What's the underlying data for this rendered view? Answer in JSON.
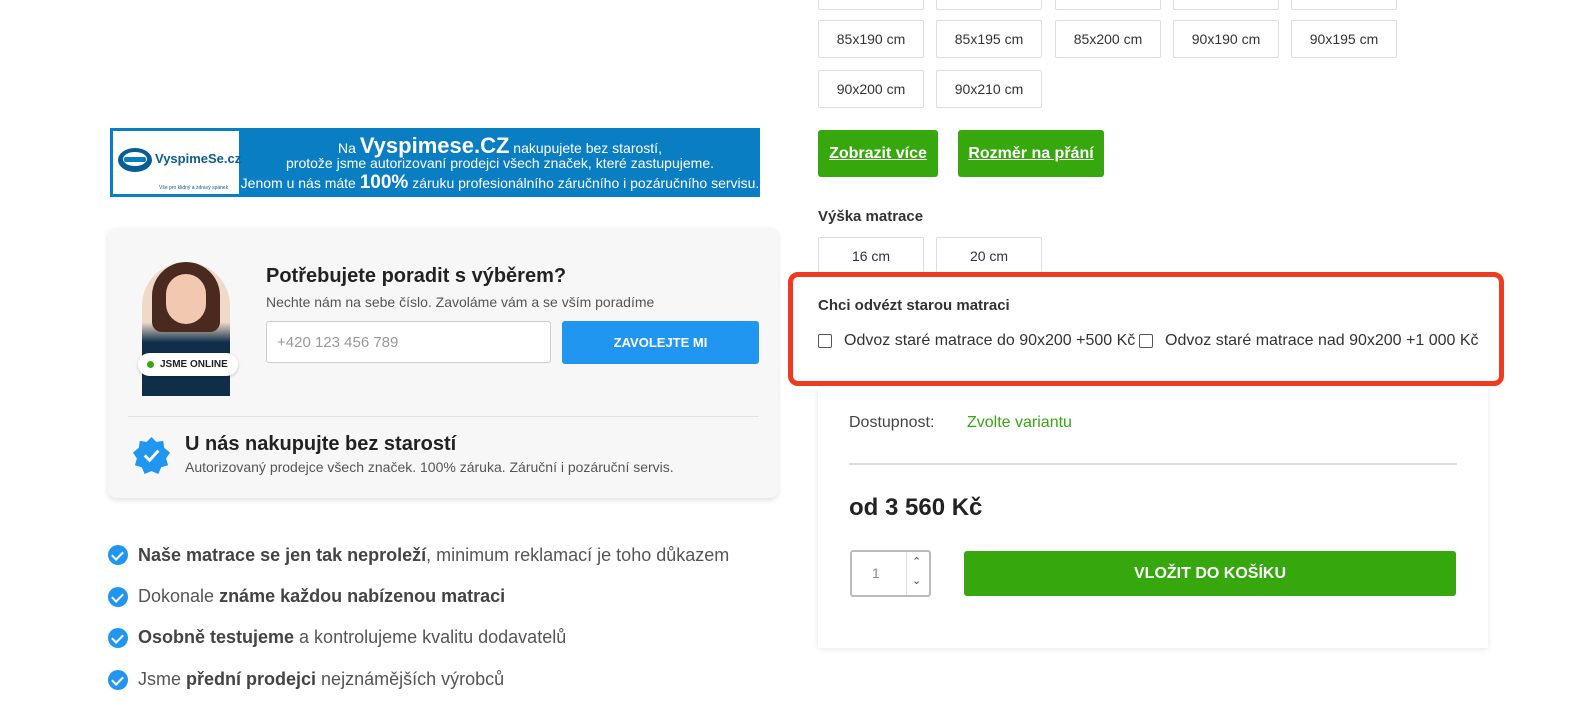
{
  "sizes": {
    "top_row": [
      "",
      "",
      "",
      "",
      ""
    ],
    "row1": [
      "85x190 cm",
      "85x195 cm",
      "85x200 cm",
      "90x190 cm",
      "90x195 cm"
    ],
    "row2": [
      "90x200 cm",
      "90x210 cm"
    ],
    "show_more": "Zobrazit více",
    "custom_size": "Rozměr na přání"
  },
  "height": {
    "label": "Výška matrace",
    "options": [
      "16 cm",
      "20 cm"
    ]
  },
  "disposal": {
    "label": "Chci odvézt starou matraci",
    "option1": "Odvoz staré matrace do 90x200 +500 Kč",
    "option2": "Odvoz staré matrace nad 90x200 +1 000 Kč",
    "highlight_color": "#ee3a1f"
  },
  "purchase": {
    "availability_label": "Dostupnost:",
    "availability_value": "Zvolte variantu",
    "price": "od 3 560 Kč",
    "quantity": "1",
    "add_to_cart": "VLOŽIT DO KOŠÍKU",
    "accent_color": "#36a80e"
  },
  "banner": {
    "logo_text": "VyspimeSe.cz",
    "logo_tagline": "Vše pro klidný a zdravý spánek",
    "line1_pre": "Na ",
    "line1_brand": "Vyspimese.CZ",
    "line1_post": " nakupujete bez starostí,",
    "line2": "protože jsme autorizovaní prodejci všech značek, které zastupujeme.",
    "line3_pre": "Jenom u nás máte ",
    "line3_big": "100%",
    "line3_post": " záruku profesionálního záručního i pozáručního servisu."
  },
  "advice": {
    "title": "Potřebujete poradit s výběrem?",
    "subtitle": "Nechte nám na sebe číslo. Zavoláme vám a se vším poradíme",
    "phone_placeholder": "+420 123 456 789",
    "call_button": "ZAVOLEJTE MI",
    "online_badge": "JSME ONLINE",
    "trust_title": "U nás nakupujte bez starostí",
    "trust_text": "Autorizovaný prodejce všech značek. 100% záruka. Záruční i pozáruční servis.",
    "primary_color": "#2196f0"
  },
  "features": [
    {
      "bold": "Naše matrace se jen tak neproleží",
      "rest": ", minimum reklamací je toho důkazem",
      "bold_first": true
    },
    {
      "pre": "Dokonale ",
      "bold": "známe každou nabízenou matraci"
    },
    {
      "bold": "Osobně testujeme",
      "rest": " a kontrolujeme kvalitu dodavatelů",
      "bold_first": true
    },
    {
      "pre": "Jsme ",
      "bold": "přední prodejci",
      "rest": " nejznámějších výrobců"
    }
  ]
}
